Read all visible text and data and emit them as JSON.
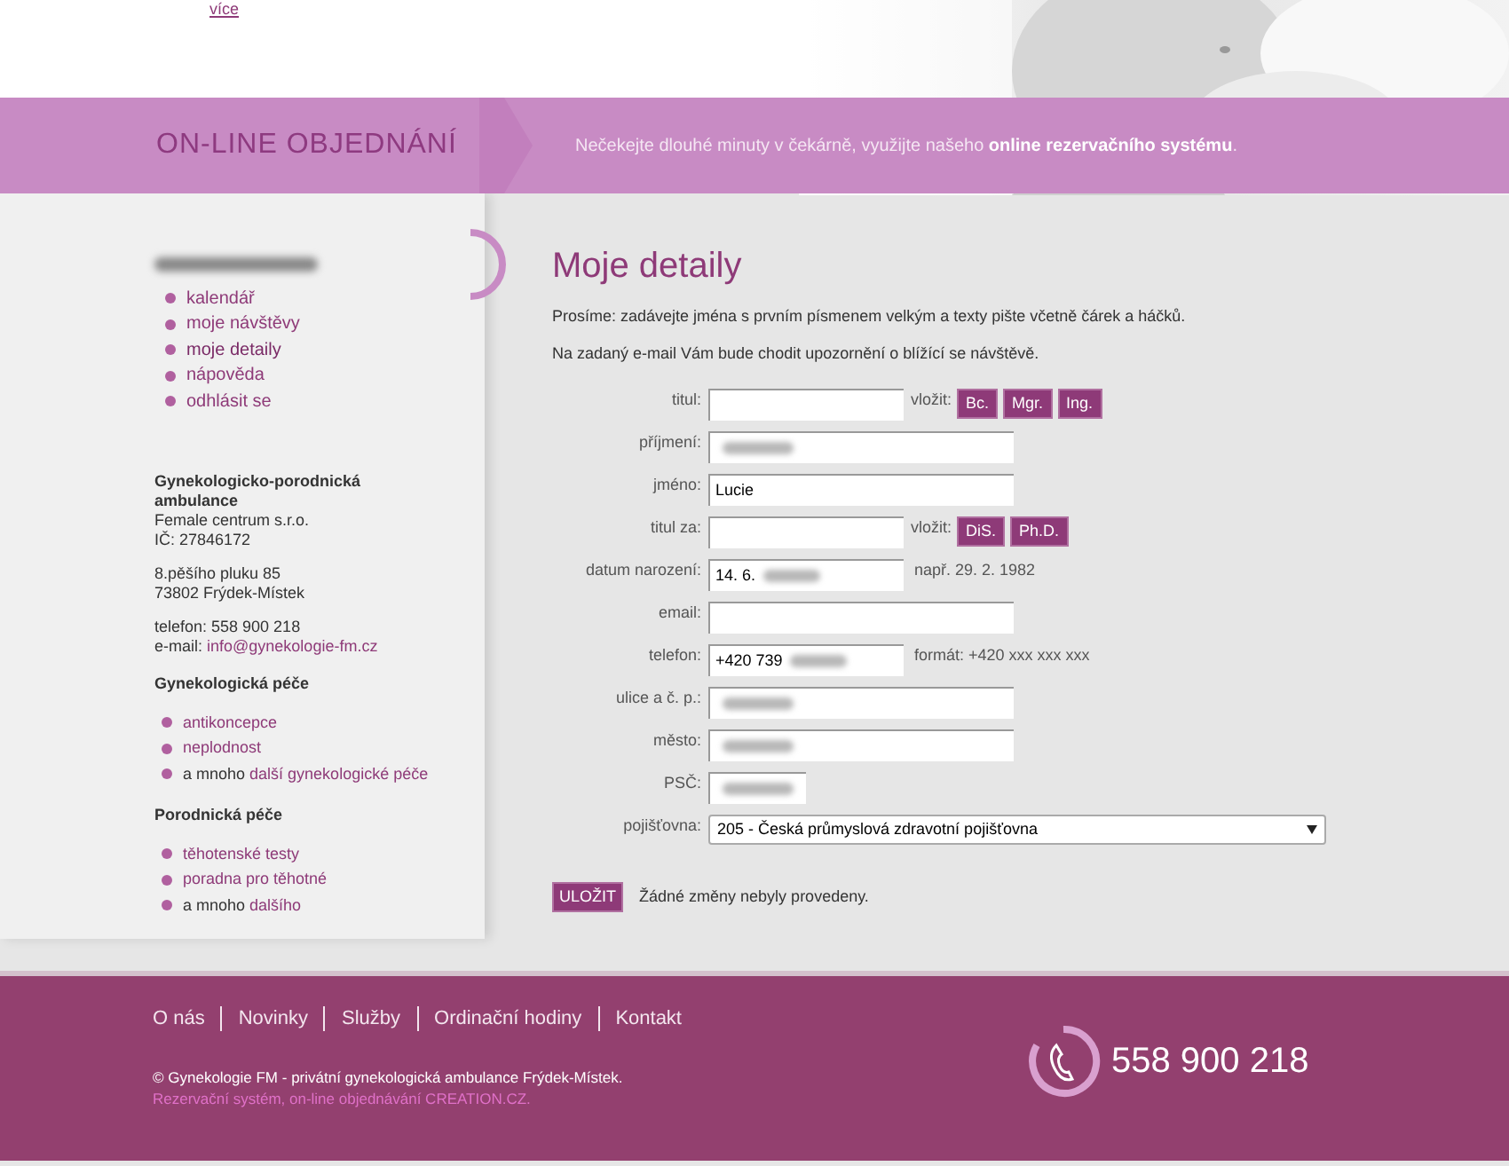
{
  "top_link": "více",
  "banner": {
    "title": "ON-LINE OBJEDNÁNÍ",
    "tagline": "Nečekejte dlouhé minuty v čekárně, využijte našeho ",
    "tagline_bold": "online rezervačního systému",
    "tagline_end": "."
  },
  "sidebar": {
    "user_name_redacted": true,
    "menu": [
      {
        "label": "kalendář",
        "selected": false
      },
      {
        "label": "moje návštěvy",
        "selected": false
      },
      {
        "label": "moje detaily",
        "selected": true
      },
      {
        "label": "nápověda",
        "selected": false
      },
      {
        "label": "odhlásit se",
        "selected": false
      }
    ],
    "company": {
      "name": "Gynekologicko-porodnická ambulance",
      "lines": [
        "Female centrum s.r.o.",
        "IČ: 27846172"
      ],
      "address": [
        "8.pěšího pluku 85",
        "73802 Frýdek-Místek"
      ],
      "phone": "telefon: 558 900 218",
      "email_label": "e-mail: ",
      "email": "info@gynekologie-fm.cz"
    },
    "sections": [
      {
        "title": "Gynekologická péče",
        "items": [
          {
            "link": "antikoncepce"
          },
          {
            "link": "neplodnost"
          },
          {
            "prefix": "a mnoho ",
            "link": "další gynekologické péče"
          }
        ]
      },
      {
        "title": "Porodnická péče",
        "items": [
          {
            "link": "těhotenské testy"
          },
          {
            "link": "poradna pro těhotné"
          },
          {
            "prefix": "a mnoho ",
            "link": "dalšího"
          }
        ]
      }
    ]
  },
  "content": {
    "title": "Moje detaily",
    "notes": [
      "Prosíme: zadávejte jména s prvním písmenem velkým a texty pište včetně čárek a háčků.",
      "Na zadaný e-mail Vám bude chodit upozornění o blížící se návštěvě."
    ],
    "fields": [
      {
        "kind": "medium",
        "label": "titul:",
        "redacted": false,
        "insert_label": "vložit:",
        "insert_buttons": [
          "Bc.",
          "Mgr.",
          "Ing."
        ]
      },
      {
        "kind": "long",
        "label": "příjmení:",
        "redacted": true
      },
      {
        "kind": "long",
        "label": "jméno:",
        "value": "Lucie",
        "redacted": false
      },
      {
        "kind": "medium",
        "label": "titul za:",
        "redacted": false,
        "insert_label": "vložit:",
        "insert_buttons": [
          "DiS.",
          "Ph.D."
        ]
      },
      {
        "kind": "medium",
        "label": "datum narození:",
        "value": "14. 6.",
        "redacted": true,
        "hint": "např. 29. 2. 1982"
      },
      {
        "kind": "long",
        "label": "email:",
        "redacted": false
      },
      {
        "kind": "medium",
        "label": "telefon:",
        "value": "+420 739",
        "redacted": true,
        "hint": "formát: +420 xxx xxx xxx"
      },
      {
        "kind": "long",
        "label": "ulice a č. p.:",
        "redacted": true
      },
      {
        "kind": "long",
        "label": "město:",
        "redacted": true
      },
      {
        "kind": "short",
        "label": "PSČ:",
        "redacted": true
      },
      {
        "kind": "select",
        "label": "pojišťovna:",
        "value": "205 - Česká průmyslová zdravotní pojišťovna"
      }
    ],
    "save_button": "ULOŽIT",
    "status": "Žádné změny nebyly provedeny."
  },
  "footer": {
    "nav": [
      "O nás",
      "Novinky",
      "Služby",
      "Ordinační hodiny",
      "Kontakt"
    ],
    "copyright": "© Gynekologie FM - privátní gynekologická ambulance Frýdek-Místek.",
    "credit": "Rezervační systém, on-line objednávání CREATION.CZ.",
    "phone": "558 900 218"
  }
}
